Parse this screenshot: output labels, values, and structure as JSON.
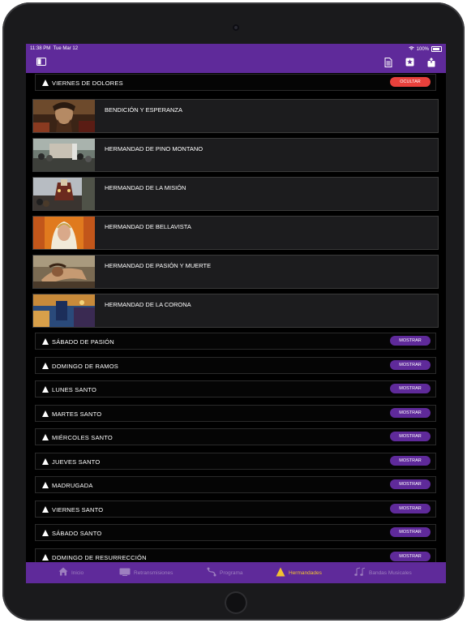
{
  "status_bar": {
    "time": "11:38 PM",
    "date": "Tue Mar 12",
    "battery": "100%"
  },
  "nav_icons": [
    "sidebar-toggle-icon",
    "document-icon",
    "star-icon",
    "share-icon"
  ],
  "colors": {
    "accent": "#5f2a9a",
    "hide_button": "#e8413c",
    "active_tab": "#f2c230",
    "inactive_tab": "#9d7fbf",
    "card_bg": "#1c1c1e"
  },
  "expanded_section": {
    "label": "VIERNES DE DOLORES",
    "button": "OCULTAR"
  },
  "cards": [
    {
      "label": "BENDICIÓN Y ESPERANZA"
    },
    {
      "label": "HERMANDAD DE PINO MONTANO"
    },
    {
      "label": "HERMANDAD DE LA MISIÓN"
    },
    {
      "label": "HERMANDAD DE BELLAVISTA"
    },
    {
      "label": "HERMANDAD DE PASIÓN Y MUERTE"
    },
    {
      "label": "HERMANDAD DE LA CORONA"
    }
  ],
  "collapsed_sections": [
    {
      "label": "SÁBADO DE PASIÓN",
      "button": "MOSTRAR"
    },
    {
      "label": "DOMINGO DE RAMOS",
      "button": "MOSTRAR"
    },
    {
      "label": "LUNES SANTO",
      "button": "MOSTRAR"
    },
    {
      "label": "MARTES SANTO",
      "button": "MOSTRAR"
    },
    {
      "label": "MIÉRCOLES SANTO",
      "button": "MOSTRAR"
    },
    {
      "label": "JUEVES SANTO",
      "button": "MOSTRAR"
    },
    {
      "label": "MADRUGADA",
      "button": "MOSTRAR"
    },
    {
      "label": "VIERNES SANTO",
      "button": "MOSTRAR"
    },
    {
      "label": "SÁBADO SANTO",
      "button": "MOSTRAR"
    },
    {
      "label": "DOMINGO DE RESURRECCIÓN",
      "button": "MOSTRAR"
    }
  ],
  "tabs": [
    {
      "label": "Inicio",
      "icon": "home-icon",
      "active": false
    },
    {
      "label": "Retransmisiones",
      "icon": "tv-icon",
      "active": false
    },
    {
      "label": "Programa",
      "icon": "route-icon",
      "active": false
    },
    {
      "label": "Hermandades",
      "icon": "capirote-icon",
      "active": true
    },
    {
      "label": "Bandas Musicales",
      "icon": "music-notes-icon",
      "active": false
    }
  ]
}
